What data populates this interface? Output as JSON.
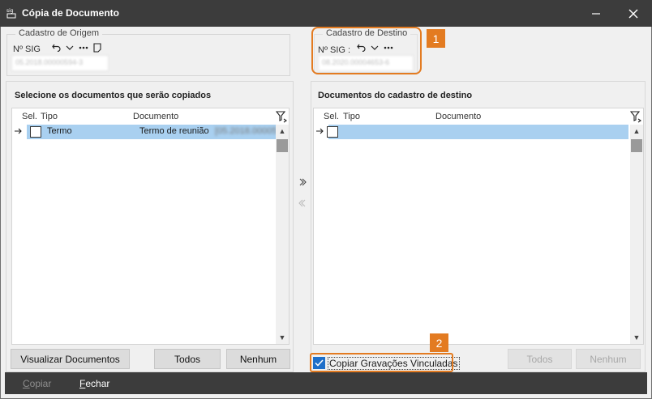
{
  "window": {
    "title": "Cópia de Documento",
    "app_icon": "sig-icon"
  },
  "origem": {
    "group_title": "Cadastro de Origem",
    "sig_label": "Nº SIG",
    "sig_value": "05.2018.00000594-3",
    "tools": [
      "undo-icon",
      "chevron-down-icon",
      "ellipsis-icon",
      "document-icon"
    ]
  },
  "destino": {
    "group_title": "Cadastro de Destino",
    "sig_label": "Nº SIG :",
    "sig_value": "08.2020.00004653-6",
    "tools": [
      "undo-icon",
      "chevron-down-icon",
      "ellipsis-icon"
    ]
  },
  "badges": {
    "one": "1",
    "two": "2"
  },
  "accent_color": "#e37b21",
  "left_panel": {
    "title": "Selecione os documentos que serão copiados",
    "columns": {
      "sel": "Sel.",
      "tipo": "Tipo",
      "documento": "Documento"
    },
    "rows": [
      {
        "tipo": "Termo",
        "documento": "Termo de reunião",
        "documento_ref": "[05.2018.000059"
      }
    ]
  },
  "right_panel": {
    "title": "Documentos do cadastro de destino",
    "columns": {
      "sel": "Sel.",
      "tipo": "Tipo",
      "documento": "Documento"
    }
  },
  "buttons": {
    "visualizar": "Visualizar Documentos",
    "todos_left": "Todos",
    "nenhum_left": "Nenhum",
    "todos_right": "Todos",
    "nenhum_right": "Nenhum"
  },
  "copy_linked": {
    "label": "Copiar Gravações Vinculadas",
    "checked": true
  },
  "footer": {
    "copiar_first": "C",
    "copiar_rest": "opiar",
    "fechar_first": "F",
    "fechar_rest": "echar"
  }
}
